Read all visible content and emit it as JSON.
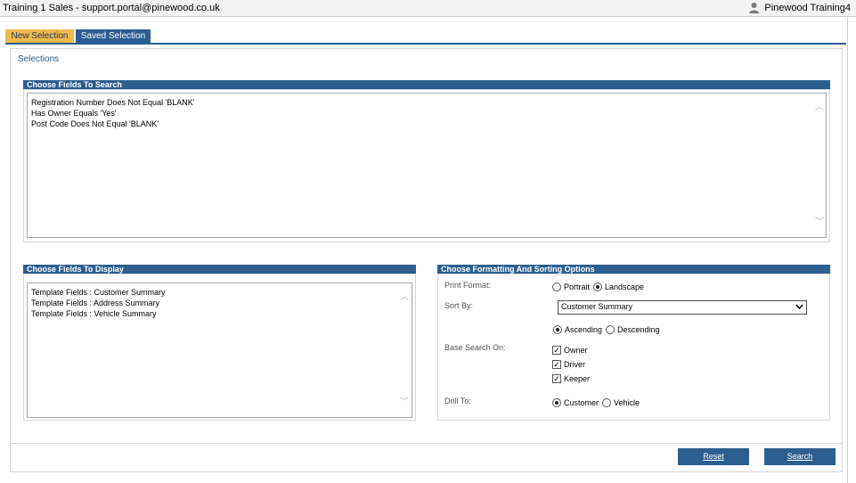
{
  "window": {
    "title": "Training 1 Sales - support.portal@pinewood.co.uk",
    "user_name": "Pinewood Training4"
  },
  "tabs": [
    {
      "label": "New Selection",
      "active": true
    },
    {
      "label": "Saved Selection",
      "active": false
    }
  ],
  "selections_label": "Selections",
  "search_fields": {
    "header": "Choose Fields To Search",
    "lines": [
      "Registration Number Does Not Equal 'BLANK'",
      "Has Owner Equals 'Yes'",
      "Post Code Does Not Equal 'BLANK'"
    ]
  },
  "display_fields": {
    "header": "Choose Fields To Display",
    "lines": [
      "Template Fields : Customer Summary",
      "Template Fields : Address Summary",
      "Template Fields : Vehicle Summary"
    ]
  },
  "options": {
    "header": "Choose Formatting And Sorting Options",
    "print_format_label": "Print Format:",
    "print_format": {
      "portrait": "Portrait",
      "landscape": "Landscape",
      "selected": "landscape"
    },
    "sort_by_label": "Sort By:",
    "sort_by_value": "Customer Summary",
    "order": {
      "ascending": "Ascending",
      "descending": "Descending",
      "selected": "ascending"
    },
    "base_search_label": "Base Search On:",
    "base_search": [
      {
        "label": "Owner",
        "checked": true
      },
      {
        "label": "Driver",
        "checked": true
      },
      {
        "label": "Keeper",
        "checked": true
      }
    ],
    "drill_to_label": "Drill To:",
    "drill_to": {
      "customer": "Customer",
      "vehicle": "Vehicle",
      "selected": "customer"
    }
  },
  "buttons": {
    "reset": "Reset",
    "search": "Search"
  },
  "colors": {
    "accent": "#2c5e8f",
    "active_tab": "#f3b84b"
  }
}
